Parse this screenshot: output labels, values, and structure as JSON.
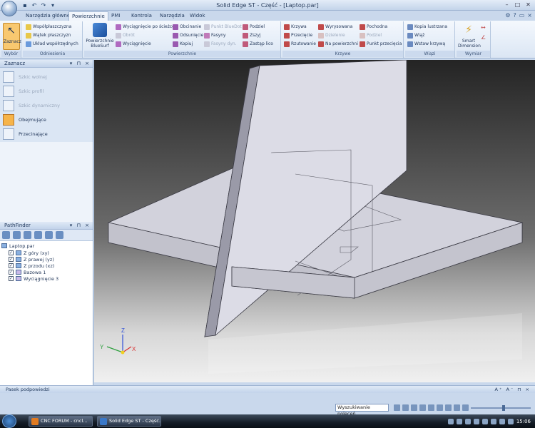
{
  "window": {
    "title": "Solid Edge ST - Część - [Laptop.par]"
  },
  "tabs": [
    {
      "label": "Narzędzia główne"
    },
    {
      "label": "Powierzchnie"
    },
    {
      "label": "PMI"
    },
    {
      "label": "Kontrola"
    },
    {
      "label": "Narzędzia"
    },
    {
      "label": "Widok"
    }
  ],
  "ribbon": {
    "wybor": {
      "big": "Zaznacz",
      "label": "Wybór"
    },
    "odniesienia": {
      "label": "Odniesienia",
      "items": [
        "Współpłaszczyzna",
        "Wątek płaszczyzn",
        "Układ współrzędnych"
      ]
    },
    "powierzchnie": {
      "label": "Powierzchnie",
      "big": "Powierzchnie BlueSurf",
      "col1": [
        "Wyciągnięcie po ścieżce",
        "Obrót",
        "Wyciągnięcie"
      ],
      "col2": [
        "Obcinanie",
        "Odsunięcie",
        "Kopiuj"
      ],
      "col3": [
        "Punkt BlueDot",
        "Fasyny",
        "Fasyny dyn."
      ],
      "col4": [
        "Podziel",
        "Zszyj",
        "Zastąp lico"
      ]
    },
    "krzywe": {
      "label": "Krzywe",
      "col1": [
        "Krzywa",
        "Przecięcie",
        "Rzutowanie"
      ],
      "col2": [
        "Wyrysowana",
        "Dzielenie",
        "Na powierzchni"
      ],
      "col3": [
        "Pochodna",
        "Podziel",
        "Punkt przecięcia"
      ]
    },
    "wiazi": {
      "label": "Wiązi",
      "items": [
        "Kopia lustrzana",
        "Wiąż",
        "Wstaw krzywą"
      ]
    },
    "wymiar": {
      "label": "Wymiar",
      "big": "Smart Dimension"
    }
  },
  "zaznacz_panel": {
    "title": "Zaznacz",
    "items": [
      {
        "label": "Szkic wolnej",
        "enabled": false
      },
      {
        "label": "Szkic profil",
        "enabled": false
      },
      {
        "label": "Szkic dynamiczny",
        "enabled": false
      },
      {
        "label": "Obejmujące",
        "enabled": true
      },
      {
        "label": "Przecinające",
        "enabled": true
      }
    ]
  },
  "pathfinder": {
    "title": "PathFinder",
    "root": "Laptop.par",
    "items": [
      {
        "label": "Z góry (xy)"
      },
      {
        "label": "Z prawej (yz)"
      },
      {
        "label": "Z przodu (xz)"
      },
      {
        "label": "Bazowa 1"
      },
      {
        "label": "Wyciągnięcie 3"
      }
    ]
  },
  "triad": {
    "z": "Z",
    "y": "Y",
    "x": "X"
  },
  "status": {
    "hint": "Pasek podpowiedzi"
  },
  "search": {
    "value": "Wyszukiwanie poleceń"
  },
  "taskbar": {
    "items": [
      {
        "label": "CNC FORUM - cncl..."
      },
      {
        "label": "Solid Edge ST - Część..."
      }
    ],
    "clock": "15:06"
  },
  "colors": {
    "accent": "#f6b44a",
    "ribbon_bg": "#dbe6f4"
  }
}
